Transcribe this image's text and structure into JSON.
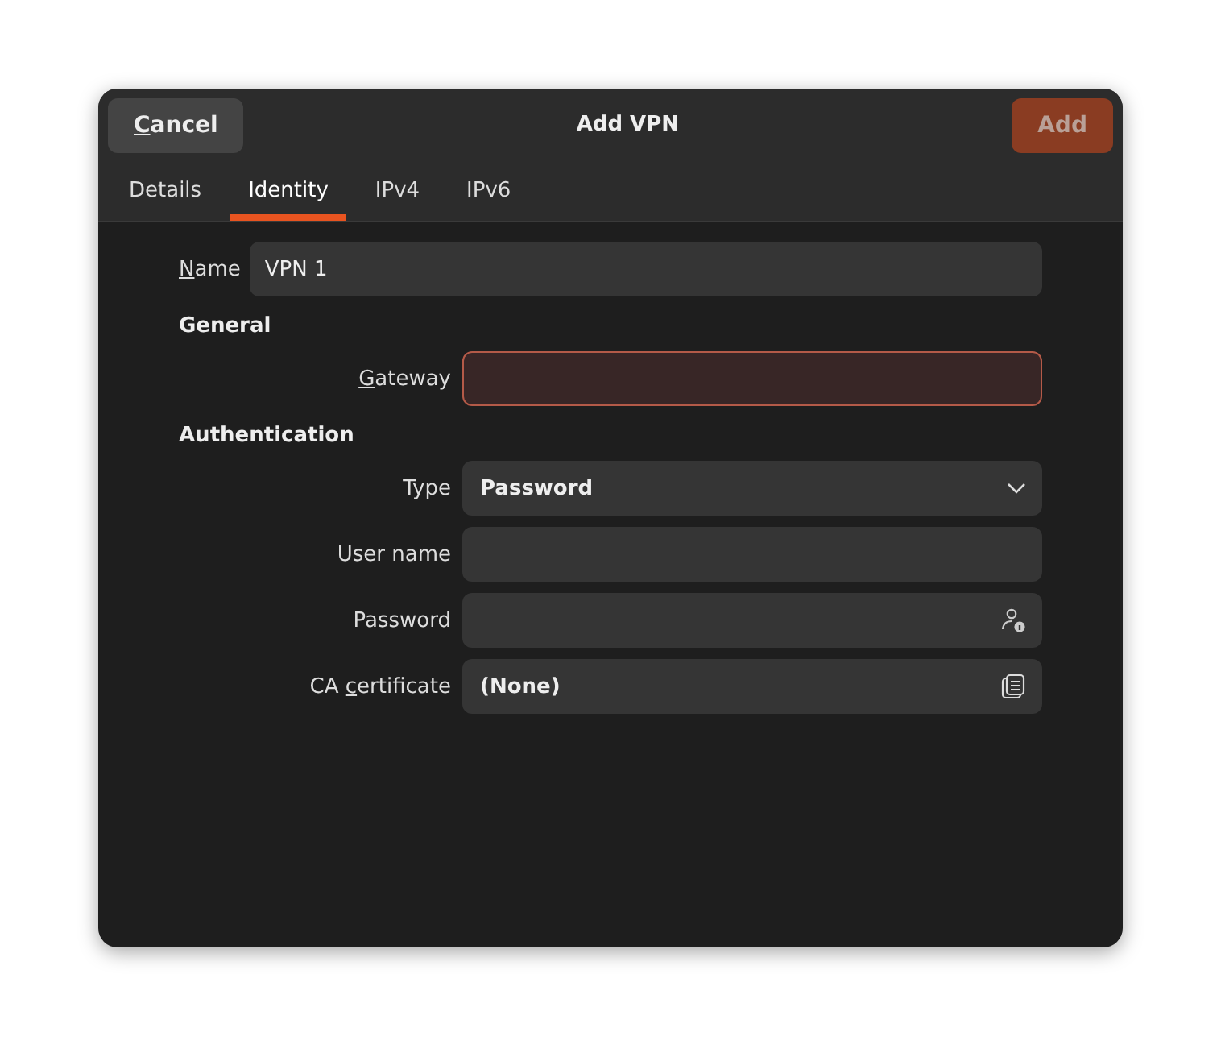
{
  "window": {
    "title": "Add VPN"
  },
  "header": {
    "cancel": {
      "key": "C",
      "after": "ancel"
    },
    "add": {
      "label": "Add",
      "disabled": true
    }
  },
  "tabs": [
    {
      "label": "Details",
      "selected": false
    },
    {
      "label": "Identity",
      "selected": true
    },
    {
      "label": "IPv4",
      "selected": false
    },
    {
      "label": "IPv6",
      "selected": false
    }
  ],
  "name_field": {
    "label": {
      "key": "N",
      "after": "ame"
    },
    "value": "VPN 1"
  },
  "sections": [
    {
      "heading": "General",
      "fields": [
        {
          "kind": "entry",
          "label": {
            "key": "G",
            "after": "ateway"
          },
          "error": true
        }
      ]
    },
    {
      "heading": "Authentication",
      "fields": [
        {
          "kind": "dropdown",
          "label": {
            "before": "Type"
          },
          "value": "Password",
          "error": false
        },
        {
          "kind": "entry",
          "label": {
            "before": "User name"
          },
          "error": false
        },
        {
          "kind": "password",
          "label": {
            "before": "Password"
          },
          "error": false
        },
        {
          "kind": "file",
          "label": {
            "before": "CA ",
            "key": "c",
            "after": "ertificate"
          },
          "value": "(None)",
          "error": false
        }
      ]
    }
  ]
}
